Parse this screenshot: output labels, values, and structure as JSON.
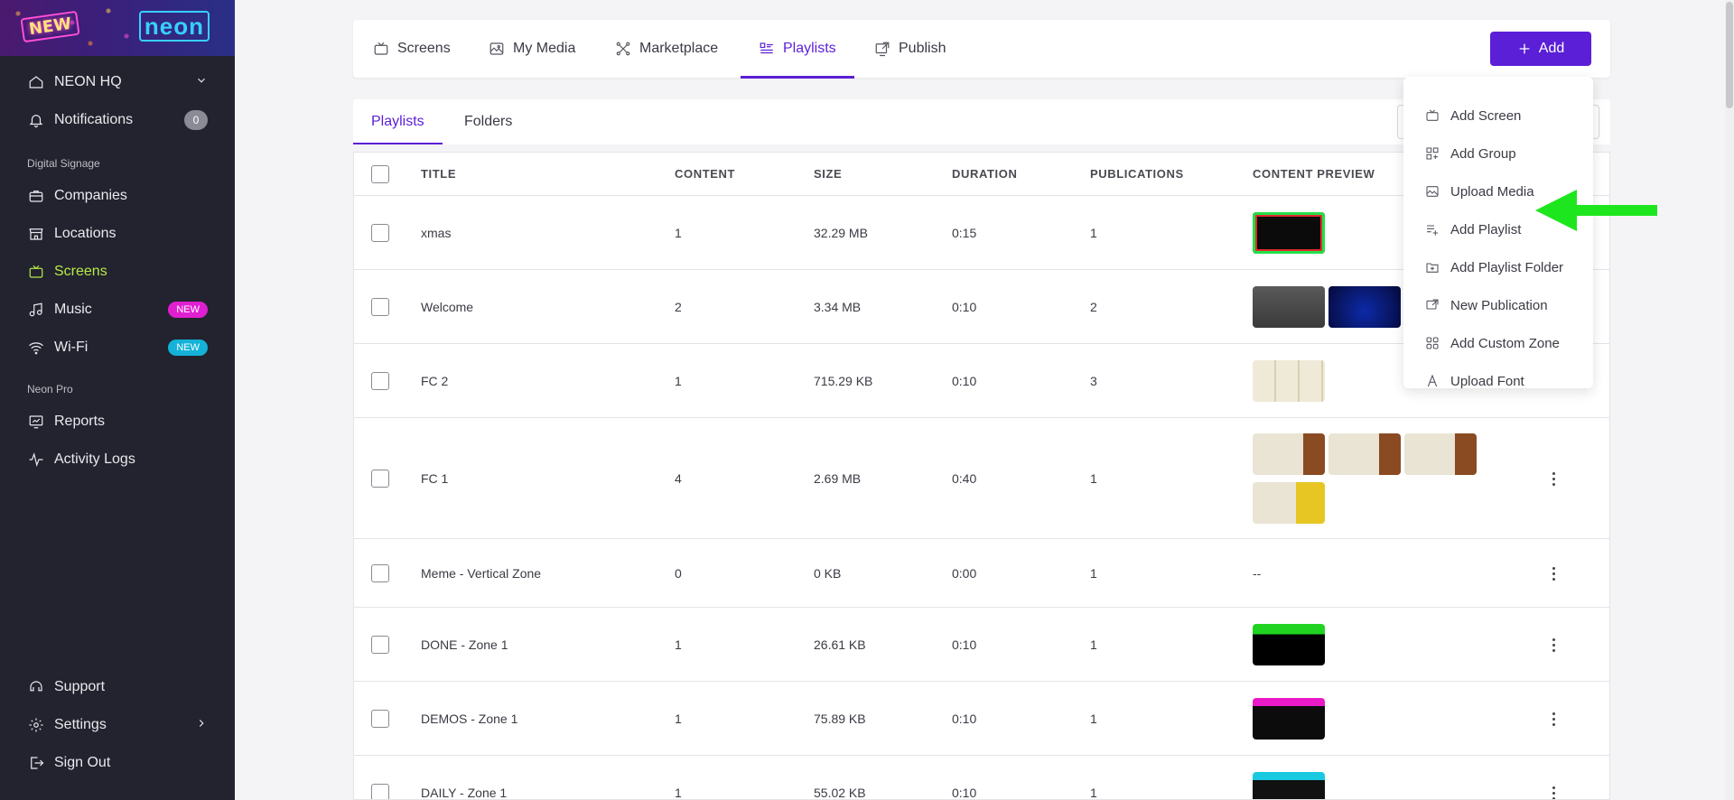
{
  "brand": {
    "badge": "NEW",
    "logo": "neon"
  },
  "sidebar": {
    "company": "NEON HQ",
    "notifications": {
      "label": "Notifications",
      "count": "0"
    },
    "section_digital": "Digital Signage",
    "items": [
      {
        "label": "Companies",
        "icon": "briefcase-icon"
      },
      {
        "label": "Locations",
        "icon": "store-icon"
      },
      {
        "label": "Screens",
        "icon": "tv-icon",
        "active": true
      },
      {
        "label": "Music",
        "icon": "music-icon",
        "badge": "NEW"
      },
      {
        "label": "Wi-Fi",
        "icon": "wifi-icon",
        "badge": "NEW"
      }
    ],
    "section_pro": "Neon Pro",
    "pro_items": [
      {
        "label": "Reports",
        "icon": "reports-icon"
      },
      {
        "label": "Activity Logs",
        "icon": "activity-icon"
      }
    ],
    "bottom": [
      {
        "label": "Support",
        "icon": "support-icon"
      },
      {
        "label": "Settings",
        "icon": "gear-icon"
      },
      {
        "label": "Sign Out",
        "icon": "sign-out-icon"
      }
    ]
  },
  "topbar": {
    "tabs": [
      {
        "label": "Screens",
        "icon": "tv-icon"
      },
      {
        "label": "My Media",
        "icon": "image-icon"
      },
      {
        "label": "Marketplace",
        "icon": "marketplace-icon"
      },
      {
        "label": "Playlists",
        "icon": "playlist-icon",
        "active": true
      },
      {
        "label": "Publish",
        "icon": "publish-icon"
      }
    ],
    "add_label": "Add"
  },
  "subtabs": [
    {
      "label": "Playlists",
      "active": true
    },
    {
      "label": "Folders"
    }
  ],
  "table": {
    "columns": [
      "TITLE",
      "CONTENT",
      "SIZE",
      "DURATION",
      "PUBLICATIONS",
      "CONTENT PREVIEW"
    ],
    "rows": [
      {
        "title": "xmas",
        "content": "1",
        "size": "32.29 MB",
        "duration": "0:15",
        "publications": "1",
        "thumbs": [
          "neon-glow"
        ]
      },
      {
        "title": "Welcome",
        "content": "2",
        "size": "3.34 MB",
        "duration": "0:10",
        "publications": "2",
        "thumbs": [
          "portrait",
          "welcome"
        ]
      },
      {
        "title": "FC 2",
        "content": "1",
        "size": "715.29 KB",
        "duration": "0:10",
        "publications": "3",
        "thumbs": [
          "menu"
        ]
      },
      {
        "title": "FC 1",
        "content": "4",
        "size": "2.69 MB",
        "duration": "0:40",
        "publications": "1",
        "thumbs": [
          "menu-food",
          "menu-food",
          "menu-food",
          "menu-yellow"
        ]
      },
      {
        "title": "Meme - Vertical Zone",
        "content": "0",
        "size": "0 KB",
        "duration": "0:00",
        "publications": "1",
        "preview_text": "--"
      },
      {
        "title": "DONE - Zone 1",
        "content": "1",
        "size": "26.61 KB",
        "duration": "0:10",
        "publications": "1",
        "thumbs": [
          "active-done"
        ]
      },
      {
        "title": "DEMOS - Zone 1",
        "content": "1",
        "size": "75.89 KB",
        "duration": "0:10",
        "publications": "1",
        "thumbs": [
          "demos"
        ]
      },
      {
        "title": "DAILY - Zone 1",
        "content": "1",
        "size": "55.02 KB",
        "duration": "0:10",
        "publications": "1",
        "thumbs": [
          "weekly"
        ]
      }
    ]
  },
  "dropdown": {
    "items": [
      {
        "label": "Add Screen",
        "icon": "tv-icon"
      },
      {
        "label": "Add Group",
        "icon": "group-icon"
      },
      {
        "label": "Upload Media",
        "icon": "image-icon"
      },
      {
        "label": "Add Playlist",
        "icon": "playlist-add-icon"
      },
      {
        "label": "Add Playlist Folder",
        "icon": "folder-add-icon"
      },
      {
        "label": "New Publication",
        "icon": "publish-icon"
      },
      {
        "label": "Add Custom Zone",
        "icon": "zone-icon"
      },
      {
        "label": "Upload Font",
        "icon": "font-icon"
      }
    ]
  },
  "colors": {
    "accent": "#5a1fd6",
    "active_nav": "#b7e94a",
    "arrow": "#1ee61e"
  }
}
